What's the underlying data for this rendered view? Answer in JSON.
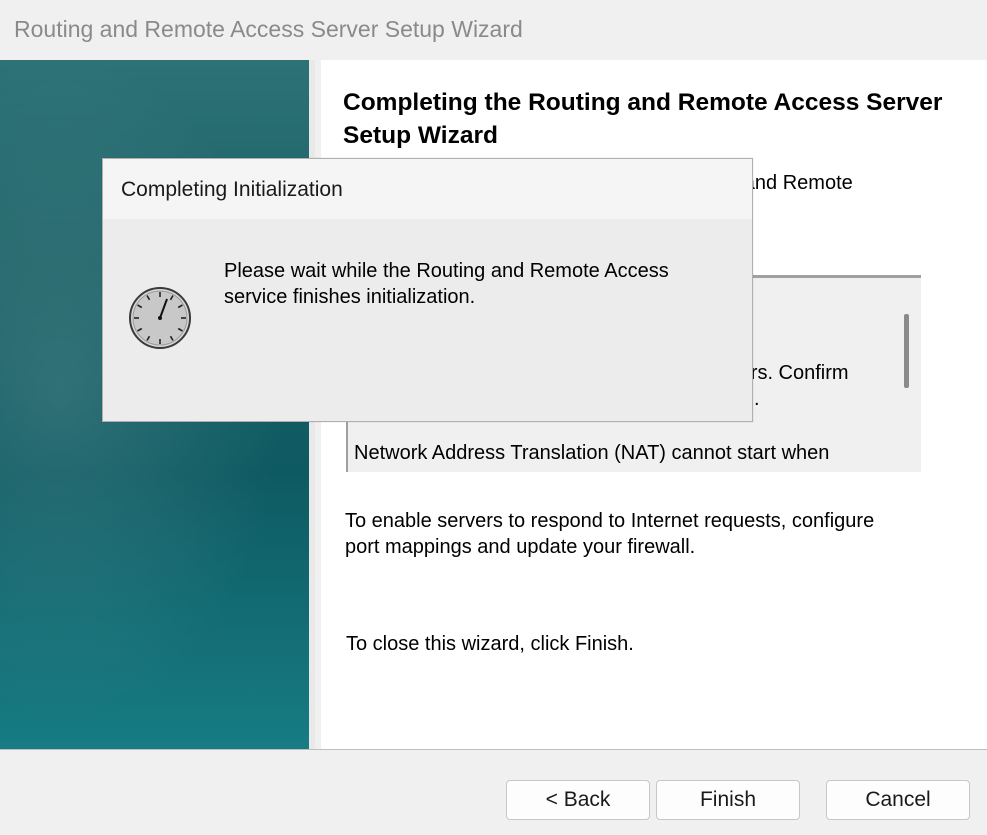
{
  "window": {
    "title": "Routing and Remote Access Server Setup Wizard"
  },
  "wizard": {
    "heading": "Completing the Routing and Remote Access Server Setup Wizard",
    "subtext_visible": "ng and Remote",
    "summary_lines": [
      "rvers. Confirm",
      ".",
      "Network Address Translation (NAT) cannot start when"
    ],
    "paragraph1": "To enable servers to respond to Internet requests, configure port mappings and update your firewall.",
    "paragraph2": "To close this wizard, click Finish."
  },
  "buttons": {
    "back": "< Back",
    "finish": "Finish",
    "cancel": "Cancel"
  },
  "dialog": {
    "title": "Completing Initialization",
    "message": "Please wait while the Routing and Remote Access service finishes initialization.",
    "icon": "clock-icon"
  }
}
